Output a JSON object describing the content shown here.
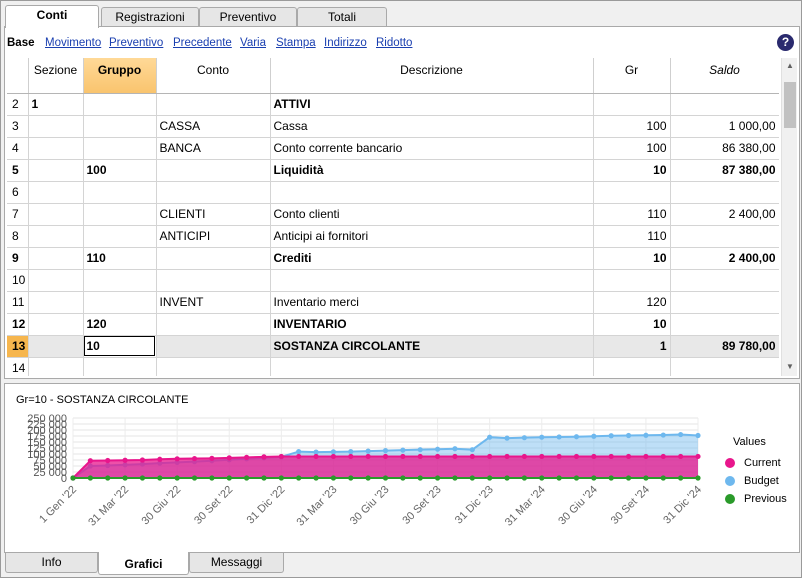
{
  "tabs_top": [
    "Conti",
    "Registrazioni",
    "Preventivo",
    "Totali"
  ],
  "subnav": {
    "base": "Base",
    "links": [
      "Movimento",
      "Preventivo",
      "Precedente",
      "Varia",
      "Stampa",
      "Indirizzo",
      "Ridotto"
    ]
  },
  "help_glyph": "?",
  "columns": [
    "Sezione",
    "Gruppo",
    "Conto",
    "Descrizione",
    "Gr",
    "Saldo"
  ],
  "rows": [
    {
      "n": "2",
      "sezione": "1",
      "gruppo": "",
      "conto": "",
      "descr": "ATTIVI",
      "gr": "",
      "saldo": "",
      "bold": false,
      "descr_bold": true
    },
    {
      "n": "3",
      "sezione": "",
      "gruppo": "",
      "conto": "CASSA",
      "descr": "Cassa",
      "gr": "100",
      "saldo": "1 000,00"
    },
    {
      "n": "4",
      "sezione": "",
      "gruppo": "",
      "conto": "BANCA",
      "descr": "Conto corrente bancario",
      "gr": "100",
      "saldo": "86 380,00"
    },
    {
      "n": "5",
      "sezione": "",
      "gruppo": "100",
      "conto": "",
      "descr": "Liquidità",
      "gr": "10",
      "saldo": "87 380,00",
      "bold": true
    },
    {
      "n": "6",
      "sezione": "",
      "gruppo": "",
      "conto": "",
      "descr": "",
      "gr": "",
      "saldo": ""
    },
    {
      "n": "7",
      "sezione": "",
      "gruppo": "",
      "conto": "CLIENTI",
      "descr": "Conto clienti",
      "gr": "110",
      "saldo": "2 400,00"
    },
    {
      "n": "8",
      "sezione": "",
      "gruppo": "",
      "conto": "ANTICIPI",
      "descr": "Anticipi ai fornitori",
      "gr": "110",
      "saldo": ""
    },
    {
      "n": "9",
      "sezione": "",
      "gruppo": "110",
      "conto": "",
      "descr": "Crediti",
      "gr": "10",
      "saldo": "2 400,00",
      "bold": true
    },
    {
      "n": "10",
      "sezione": "",
      "gruppo": "",
      "conto": "",
      "descr": "",
      "gr": "",
      "saldo": ""
    },
    {
      "n": "11",
      "sezione": "",
      "gruppo": "",
      "conto": "INVENT",
      "descr": "Inventario merci",
      "gr": "120",
      "saldo": ""
    },
    {
      "n": "12",
      "sezione": "",
      "gruppo": "120",
      "conto": "",
      "descr": "INVENTARIO",
      "gr": "10",
      "saldo": "",
      "bold": true
    },
    {
      "n": "13",
      "sezione": "",
      "gruppo": "10",
      "conto": "",
      "descr": "SOSTANZA CIRCOLANTE",
      "gr": "1",
      "saldo": "89 780,00",
      "bold": true,
      "current": true
    },
    {
      "n": "14",
      "sezione": "",
      "gruppo": "",
      "conto": "",
      "descr": "",
      "gr": "",
      "saldo": ""
    }
  ],
  "chart_title": "Gr=10 - SOSTANZA CIRCOLANTE",
  "chart_data": {
    "type": "area",
    "title": "Gr=10 - SOSTANZA CIRCOLANTE",
    "xlabel": "",
    "ylabel": "",
    "ylim": [
      0,
      250000
    ],
    "yticks": [
      0,
      25000,
      50000,
      75000,
      100000,
      125000,
      150000,
      175000,
      200000,
      225000,
      250000
    ],
    "ytick_labels": [
      "0",
      "25 000",
      "50 000",
      "75 000",
      "100 000",
      "125 000",
      "150 000",
      "175 000",
      "200 000",
      "225 000",
      "250 000"
    ],
    "xtick_labels": [
      "1 Gen '22",
      "31 Mar '22",
      "30 Giu '22",
      "30 Set '22",
      "31 Dic '22",
      "31 Mar '23",
      "30 Giu '23",
      "30 Set '23",
      "31 Dic '23",
      "31 Mar '24",
      "30 Giu '24",
      "30 Set '24",
      "31 Dic '24"
    ],
    "n_points": 37,
    "grid": true,
    "legend_title": "Values",
    "legend_position": "right",
    "series": [
      {
        "name": "Current",
        "color": "#e8168c",
        "values": [
          0,
          72000,
          73000,
          74000,
          75000,
          78000,
          80000,
          81000,
          82000,
          84000,
          86000,
          88000,
          89780,
          89780,
          89780,
          89780,
          89780,
          89780,
          89780,
          89780,
          89780,
          89780,
          89780,
          89780,
          89780,
          89780,
          89780,
          89780,
          89780,
          89780,
          89780,
          89780,
          89780,
          89780,
          89780,
          89780,
          89780
        ]
      },
      {
        "name": "Budget",
        "color": "#6eb8ee",
        "values": [
          0,
          50000,
          52000,
          55000,
          58000,
          62000,
          65000,
          68000,
          72000,
          76000,
          80000,
          84000,
          88000,
          110000,
          108000,
          109000,
          110000,
          112000,
          114000,
          116000,
          118000,
          120000,
          122000,
          118000,
          170000,
          166000,
          168000,
          170000,
          171000,
          172000,
          174000,
          176000,
          177000,
          178000,
          179000,
          181000,
          177000
        ]
      },
      {
        "name": "Previous",
        "color": "#2a9a2a",
        "values": [
          0,
          0,
          0,
          0,
          0,
          0,
          0,
          0,
          0,
          0,
          0,
          0,
          0,
          0,
          0,
          0,
          0,
          0,
          0,
          0,
          0,
          0,
          0,
          0,
          0,
          0,
          0,
          0,
          0,
          0,
          0,
          0,
          0,
          0,
          0,
          0,
          0
        ]
      }
    ]
  },
  "tabs_bottom": [
    "Info",
    "Grafici",
    "Messaggi"
  ]
}
